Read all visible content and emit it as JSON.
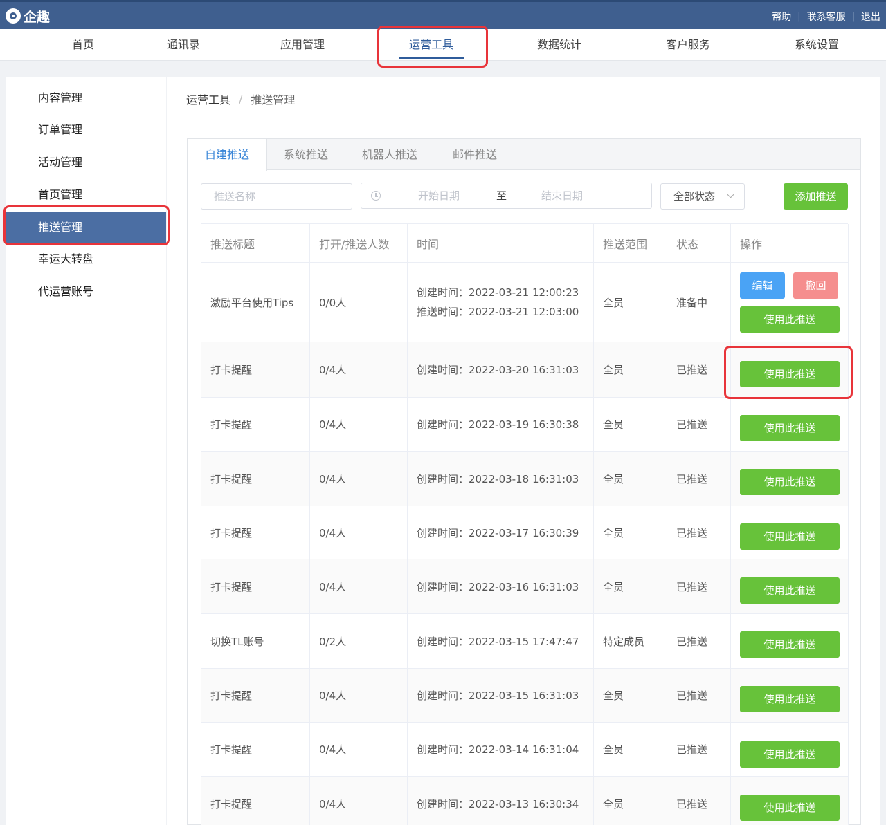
{
  "header": {
    "logo_text": "企趣",
    "links": [
      "帮助",
      "联系客服",
      "退出"
    ],
    "separator": "|"
  },
  "nav": [
    "首页",
    "通讯录",
    "应用管理",
    "运营工具",
    "数据统计",
    "客户服务",
    "系统设置"
  ],
  "sidebar": [
    "内容管理",
    "订单管理",
    "活动管理",
    "首页管理",
    "推送管理",
    "幸运大转盘",
    "代运营账号"
  ],
  "breadcrumb": {
    "root": "运营工具",
    "sep": "/",
    "current": "推送管理"
  },
  "tabs": [
    "自建推送",
    "系统推送",
    "机器人推送",
    "邮件推送"
  ],
  "filters": {
    "name_placeholder": "推送名称",
    "start_placeholder": "开始日期",
    "to": "至",
    "end_placeholder": "结束日期",
    "status": "全部状态"
  },
  "buttons": {
    "add": "添加推送",
    "edit": "编辑",
    "revoke": "撤回",
    "use": "使用此推送"
  },
  "table": {
    "headers": [
      "推送标题",
      "打开/推送人数",
      "时间",
      "推送范围",
      "状态",
      "操作"
    ],
    "rows": [
      {
        "title": "激励平台使用Tips",
        "count": "0/0人",
        "created": "创建时间：2022-03-21 12:00:23",
        "pushed": "推送时间：2022-03-21 12:03:00",
        "scope": "全员",
        "status": "准备中"
      },
      {
        "title": "打卡提醒",
        "count": "0/4人",
        "created": "创建时间：2022-03-20 16:31:03",
        "scope": "全员",
        "status": "已推送"
      },
      {
        "title": "打卡提醒",
        "count": "0/4人",
        "created": "创建时间：2022-03-19 16:30:38",
        "scope": "全员",
        "status": "已推送"
      },
      {
        "title": "打卡提醒",
        "count": "0/4人",
        "created": "创建时间：2022-03-18 16:31:03",
        "scope": "全员",
        "status": "已推送"
      },
      {
        "title": "打卡提醒",
        "count": "0/4人",
        "created": "创建时间：2022-03-17 16:30:39",
        "scope": "全员",
        "status": "已推送"
      },
      {
        "title": "打卡提醒",
        "count": "0/4人",
        "created": "创建时间：2022-03-16 16:31:03",
        "scope": "全员",
        "status": "已推送"
      },
      {
        "title": "切换TL账号",
        "count": "0/2人",
        "created": "创建时间：2022-03-15 17:47:47",
        "scope": "特定成员",
        "status": "已推送"
      },
      {
        "title": "打卡提醒",
        "count": "0/4人",
        "created": "创建时间：2022-03-15 16:31:03",
        "scope": "全员",
        "status": "已推送"
      },
      {
        "title": "打卡提醒",
        "count": "0/4人",
        "created": "创建时间：2022-03-14 16:31:04",
        "scope": "全员",
        "status": "已推送"
      },
      {
        "title": "打卡提醒",
        "count": "0/4人",
        "created": "创建时间：2022-03-13 16:30:34",
        "scope": "全员",
        "status": "已推送"
      }
    ]
  },
  "colors": {
    "header": "#3f5f8f",
    "accent": "#2f5c9b",
    "primary_green": "#67c23a",
    "edit_blue": "#4aa3f5",
    "revoke_red": "#f58e8e",
    "highlight": "#e8343a"
  }
}
